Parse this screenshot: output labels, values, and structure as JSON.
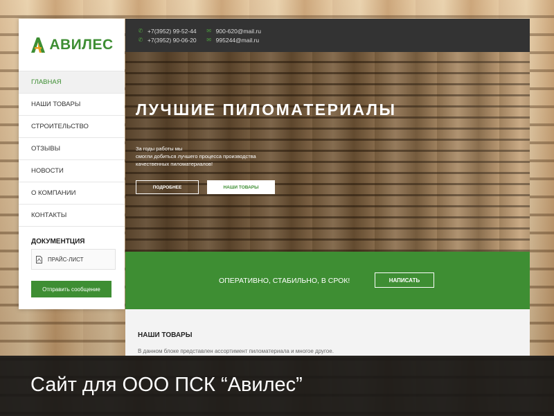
{
  "brand": {
    "logo_text": "АВИЛЕС",
    "accent": "#3e8e33"
  },
  "sidebar": {
    "menu": [
      {
        "label": "ГЛАВНАЯ"
      },
      {
        "label": "НАШИ ТОВАРЫ"
      },
      {
        "label": "СТРОИТЕЛЬСТВО"
      },
      {
        "label": "ОТЗЫВЫ"
      },
      {
        "label": "НОВОСТИ"
      },
      {
        "label": "О КОМПАНИИ"
      },
      {
        "label": "КОНТАКТЫ"
      }
    ],
    "documents_title": "ДОКУМЕНТЦИЯ",
    "price_list": "ПРАЙС-ЛИСТ",
    "send_button": "Отправить сообщение"
  },
  "topbar": {
    "phones": [
      "+7(3952) 99-52-44",
      "+7(3952) 90-06-20"
    ],
    "emails": [
      "900-620@mail.ru",
      "995244@mail.ru"
    ]
  },
  "hero": {
    "title": "ЛУЧШИЕ ПИЛОМАТЕРИАЛЫ",
    "subtitle_lines": [
      "За годы работы мы",
      "смогли добиться лучшего процесса производства",
      "качественных пиломатериалов!"
    ],
    "btn_more": "ПОДРОБНЕЕ",
    "btn_products": "НАШИ ТОВАРЫ"
  },
  "band": {
    "text": "ОПЕРАТИВНО, СТАБИЛЬНО, В СРОК!",
    "button": "НАПИСАТЬ"
  },
  "products": {
    "title": "НАШИ ТОВАРЫ",
    "description": "В данном блоке представлен ассортимент пиломатериала и многое другое."
  },
  "caption": "Сайт для ООО ПСК “Авилес”"
}
